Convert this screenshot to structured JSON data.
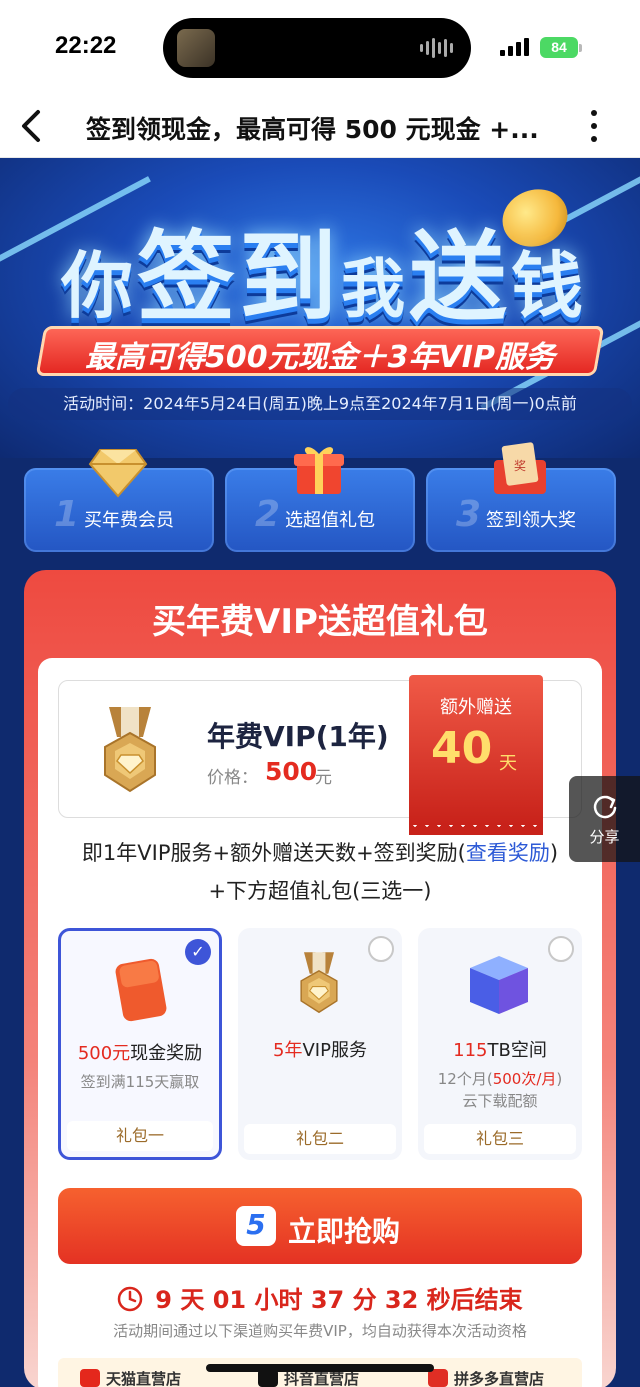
{
  "status_bar": {
    "time": "22:22",
    "battery": "84"
  },
  "nav": {
    "title": "签到领现金，最高可得 500 元现金 +..."
  },
  "hero": {
    "title_chars": [
      "你",
      "签",
      "到",
      "我",
      "送",
      "钱"
    ],
    "subtitle": "最高可得500元现金＋3年VIP服务",
    "activity_time": "活动时间：2024年5月24日(周五)晚上9点至2024年7月1日(周一)0点前"
  },
  "steps": [
    {
      "num": "1",
      "label": "买年费会员"
    },
    {
      "num": "2",
      "label": "选超值礼包"
    },
    {
      "num": "3",
      "label": "签到领大奖"
    }
  ],
  "offer": {
    "title": "买年费VIP送超值礼包",
    "vip_name": "年费VIP(1年)",
    "price_label": "价格：",
    "price_value": "500",
    "price_unit": "元",
    "bonus_label": "额外赠送",
    "bonus_days": "40",
    "bonus_unit": "天",
    "desc_line1_a": "即1年VIP服务+额外赠送天数+签到奖励(",
    "desc_line1_link": "查看奖励",
    "desc_line1_b": ")",
    "desc_line2": "+下方超值礼包(三选一)"
  },
  "packs": [
    {
      "hl": "500元",
      "title": "现金奖励",
      "sub": "签到满115天赢取",
      "foot": "礼包一",
      "selected": true
    },
    {
      "hl": "5年",
      "title": "VIP服务",
      "sub": "",
      "foot": "礼包二",
      "selected": false
    },
    {
      "hl": "115",
      "title": "TB空间",
      "sub_a": "12个月(",
      "sub_hl": "500次/月",
      "sub_b": ")",
      "sub2": "云下载配额",
      "foot": "礼包三",
      "selected": false
    }
  ],
  "buy": {
    "logo": "5",
    "label": "立即抢购"
  },
  "countdown": "9 天 01 小时 37 分 32 秒后结束",
  "note": "活动期间通过以下渠道购买年费VIP，均自动获得本次活动资格",
  "stores": [
    "天猫直营店",
    "抖音直营店",
    "拼多多直营店"
  ],
  "share": {
    "label": "分享"
  },
  "colors": {
    "accent_red": "#e42b20",
    "accent_blue": "#3e55d8",
    "hero_blue": "#1a4bb8"
  }
}
